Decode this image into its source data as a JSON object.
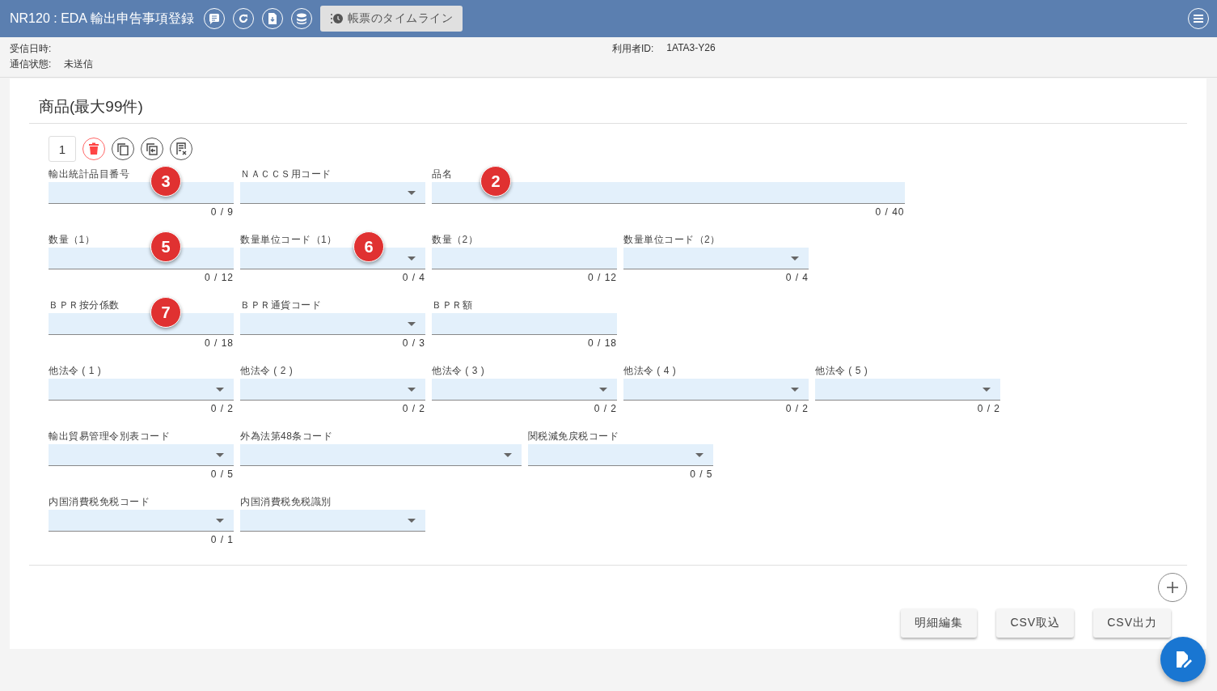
{
  "header": {
    "title": "NR120 : EDA 輸出申告事項登録",
    "timeline_button": "帳票のタイムライン"
  },
  "info": {
    "received_label": "受信日時:",
    "status_label": "通信状態:",
    "status_value": "未送信",
    "user_label": "利用者ID:",
    "user_value": "1ATA3-Y26"
  },
  "section": {
    "title": "商品(最大99件)",
    "item_number": "1"
  },
  "rows": [
    [
      {
        "label": "輸出統計品目番号",
        "kind": "text",
        "counter": "0 / 9",
        "marker": "3"
      },
      {
        "label": "ＮＡＣＣＳ用コード",
        "kind": "select"
      },
      {
        "label": "品名",
        "kind": "text",
        "counter": "0 / 40",
        "marker": "2"
      }
    ],
    [
      {
        "label": "数量（1）",
        "kind": "text",
        "counter": "0 / 12",
        "marker": "5"
      },
      {
        "label": "数量単位コード（1）",
        "kind": "select",
        "counter": "0 / 4",
        "marker": "6"
      },
      {
        "label": "数量（2）",
        "kind": "text",
        "counter": "0 / 12"
      },
      {
        "label": "数量単位コード（2）",
        "kind": "select",
        "counter": "0 / 4"
      }
    ],
    [
      {
        "label": "ＢＰＲ按分係数",
        "kind": "text",
        "counter": "0 / 18",
        "marker": "7"
      },
      {
        "label": "ＢＰＲ通貨コード",
        "kind": "select",
        "counter": "0 / 3"
      },
      {
        "label": "ＢＰＲ額",
        "kind": "text",
        "counter": "0 / 18"
      }
    ],
    [
      {
        "label": "他法令 ( 1 )",
        "kind": "select",
        "counter": "0 / 2"
      },
      {
        "label": "他法令 ( 2 )",
        "kind": "select",
        "counter": "0 / 2"
      },
      {
        "label": "他法令 ( 3 )",
        "kind": "select",
        "counter": "0 / 2"
      },
      {
        "label": "他法令 ( 4 )",
        "kind": "select",
        "counter": "0 / 2"
      },
      {
        "label": "他法令 ( 5 )",
        "kind": "select",
        "counter": "0 / 2"
      }
    ],
    [
      {
        "label": "輸出貿易管理令別表コード",
        "kind": "select",
        "counter": "0 / 5"
      },
      {
        "label": "外為法第48条コード",
        "kind": "select"
      },
      {
        "label": "関税減免戻税コード",
        "kind": "select",
        "counter": "0 / 5"
      }
    ],
    [
      {
        "label": "内国消費税免税コード",
        "kind": "select",
        "counter": "0 / 1"
      },
      {
        "label": "内国消費税免税識別",
        "kind": "select"
      }
    ]
  ],
  "buttons": [
    "明細編集",
    "CSV取込",
    "CSV出力"
  ]
}
